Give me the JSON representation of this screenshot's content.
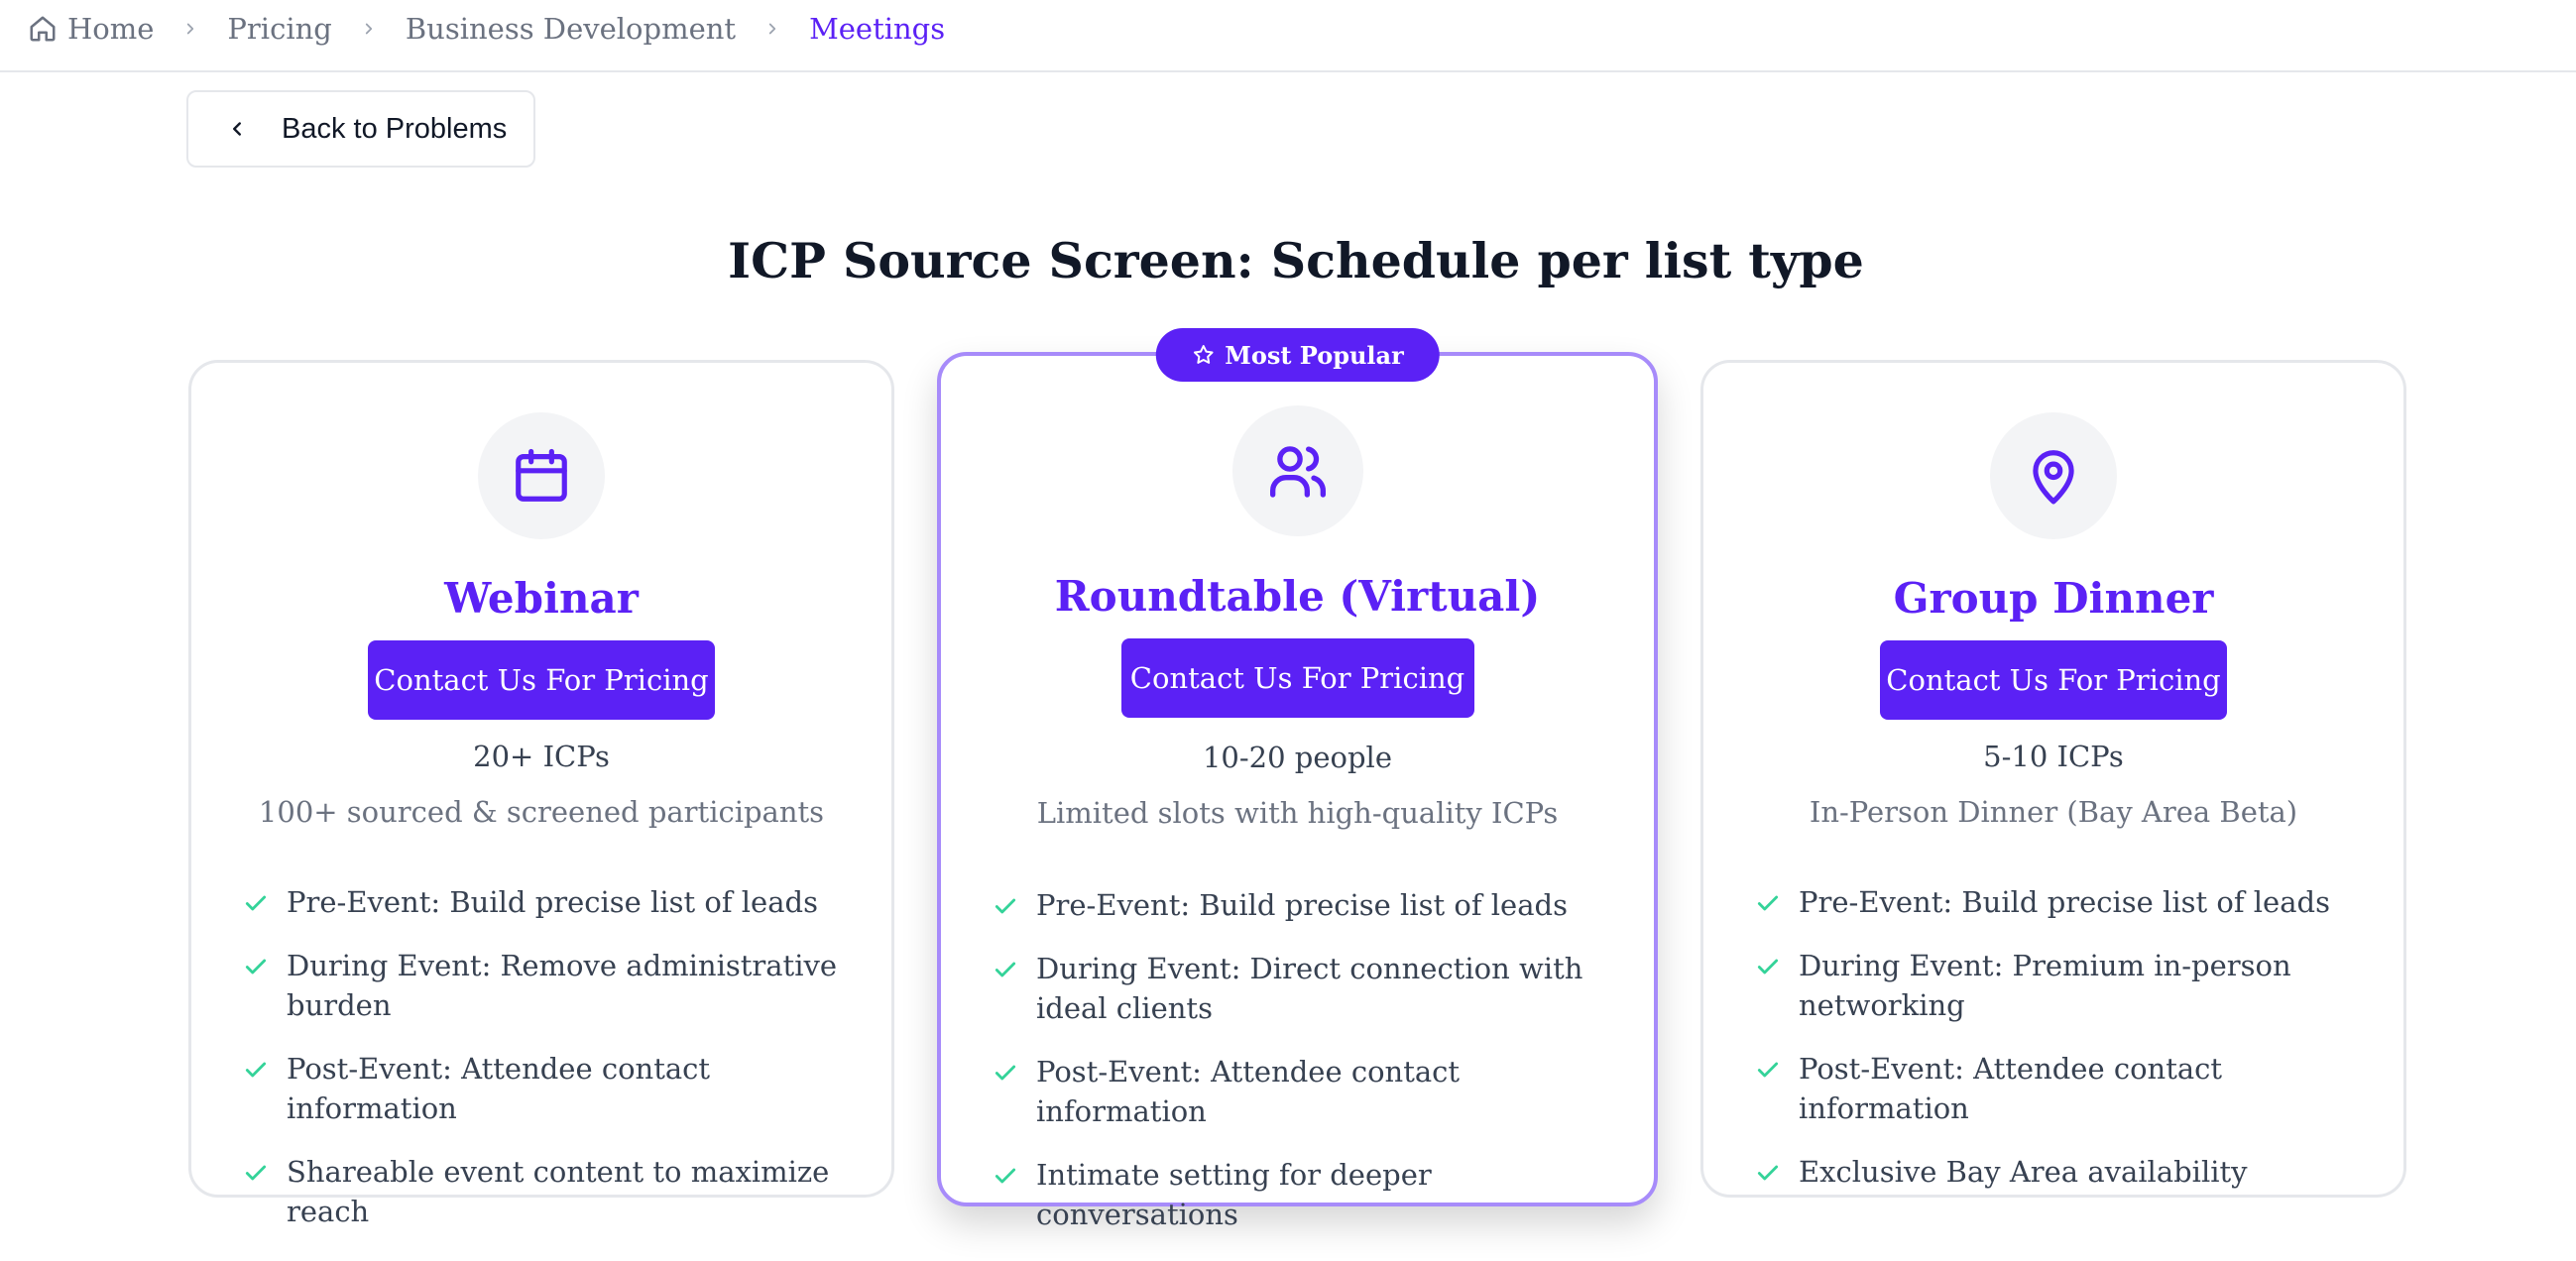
{
  "breadcrumb": {
    "items": [
      "Home",
      "Pricing",
      "Business Development",
      "Meetings"
    ]
  },
  "back_button": {
    "label": "Back to Problems"
  },
  "page_title": "ICP Source Screen: Schedule per list type",
  "colors": {
    "accent": "#5b21f5",
    "check": "#34d399",
    "popular_border": "#a78bfa"
  },
  "plans": [
    {
      "icon": "calendar-icon",
      "name": "Webinar",
      "cta": "Contact Us For Pricing",
      "capacity": "20+ ICPs",
      "subtitle": "100+ sourced & screened participants",
      "features": [
        "Pre-Event: Build precise list of leads",
        "During Event: Remove administrative burden",
        "Post-Event: Attendee contact information",
        "Shareable event content to maximize reach"
      ]
    },
    {
      "icon": "users-icon",
      "badge": "Most Popular",
      "name": "Roundtable (Virtual)",
      "cta": "Contact Us For Pricing",
      "capacity": "10-20 people",
      "subtitle": "Limited slots with high-quality ICPs",
      "features": [
        "Pre-Event: Build precise list of leads",
        "During Event: Direct connection with ideal clients",
        "Post-Event: Attendee contact information",
        "Intimate setting for deeper conversations"
      ]
    },
    {
      "icon": "map-pin-icon",
      "name": "Group Dinner",
      "cta": "Contact Us For Pricing",
      "capacity": "5-10 ICPs",
      "subtitle": "In-Person Dinner (Bay Area Beta)",
      "features": [
        "Pre-Event: Build precise list of leads",
        "During Event: Premium in-person networking",
        "Post-Event: Attendee contact information",
        "Exclusive Bay Area availability"
      ]
    }
  ]
}
